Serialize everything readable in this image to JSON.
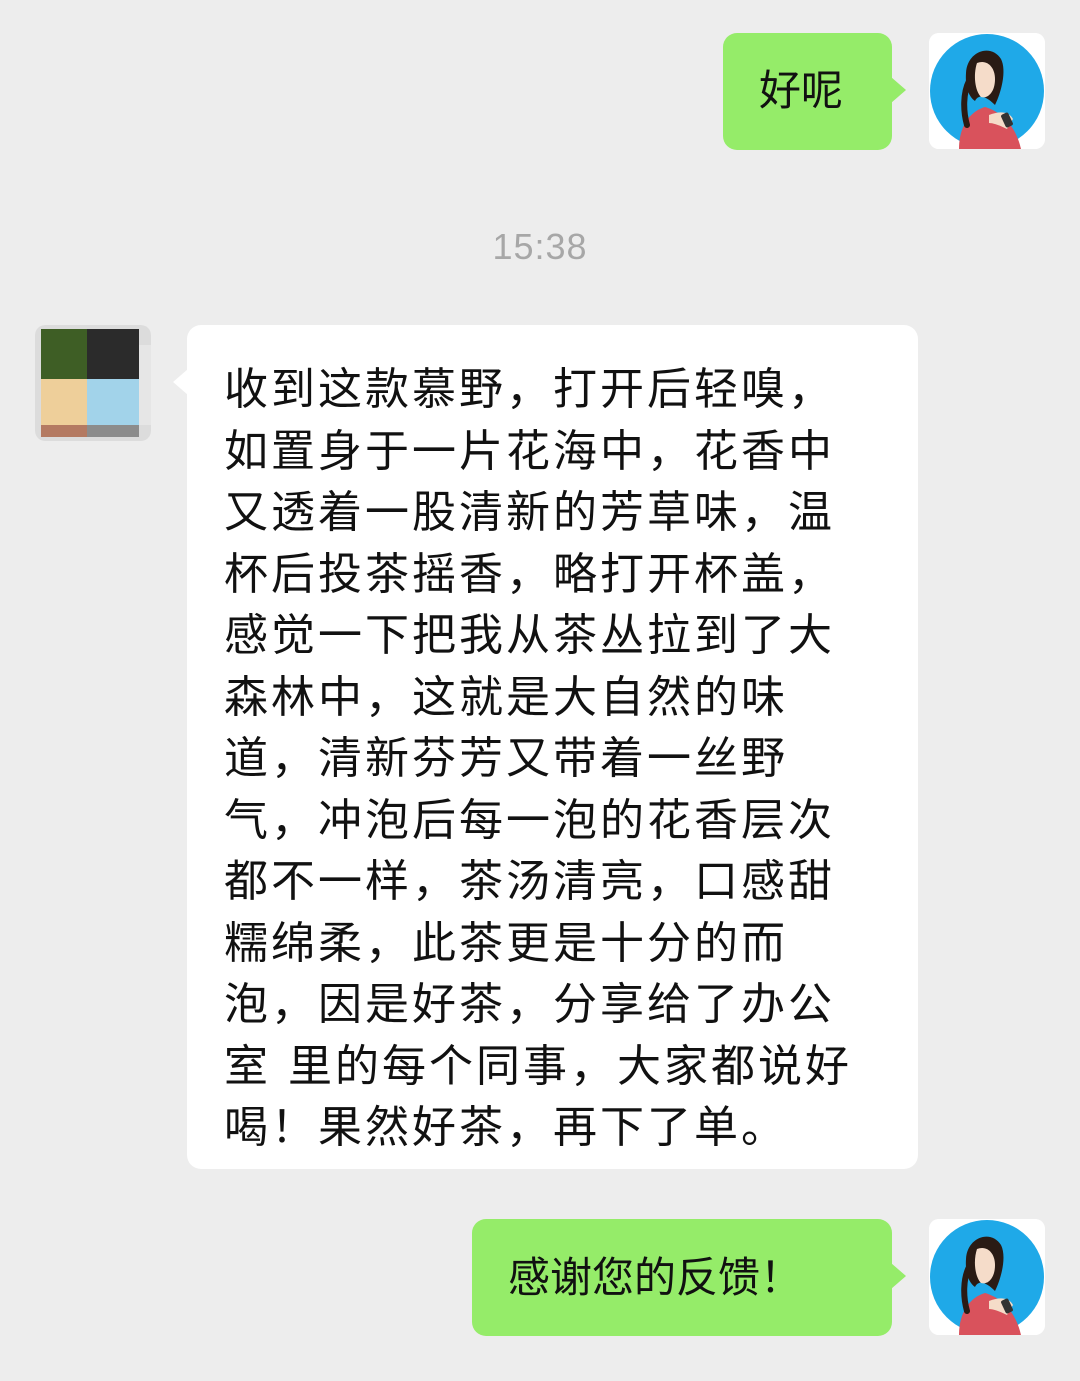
{
  "chat": {
    "timestamp": "15:38",
    "messages": [
      {
        "side": "sent",
        "text": "好呢",
        "avatar": "woman-illustration-avatar"
      },
      {
        "side": "received",
        "text": "收到这款慕野，打开后轻嗅，如置身于一片花海中，花香中又透着一股清新的芳草味，温杯后投茶摇香，略打开杯盖，感觉一下把我从茶丛拉到了大森林中，这就是大自然的味道，清新芬芳又带着一丝野气，冲泡后每一泡的花香层次都不一样，茶汤清亮，口感甜糯绵柔，此茶更是十分的而泡，因是好茶，分享给了办公室 里的每个同事，大家都说好喝！果然好茶，再下了单。",
        "avatar": "pixelated-customer-avatar"
      },
      {
        "side": "sent",
        "text": "感谢您的反馈！",
        "avatar": "woman-illustration-avatar"
      }
    ]
  },
  "colors": {
    "background": "#ededed",
    "sent_bubble": "#95ec69",
    "received_bubble": "#ffffff",
    "timestamp": "#a7a7a7"
  }
}
